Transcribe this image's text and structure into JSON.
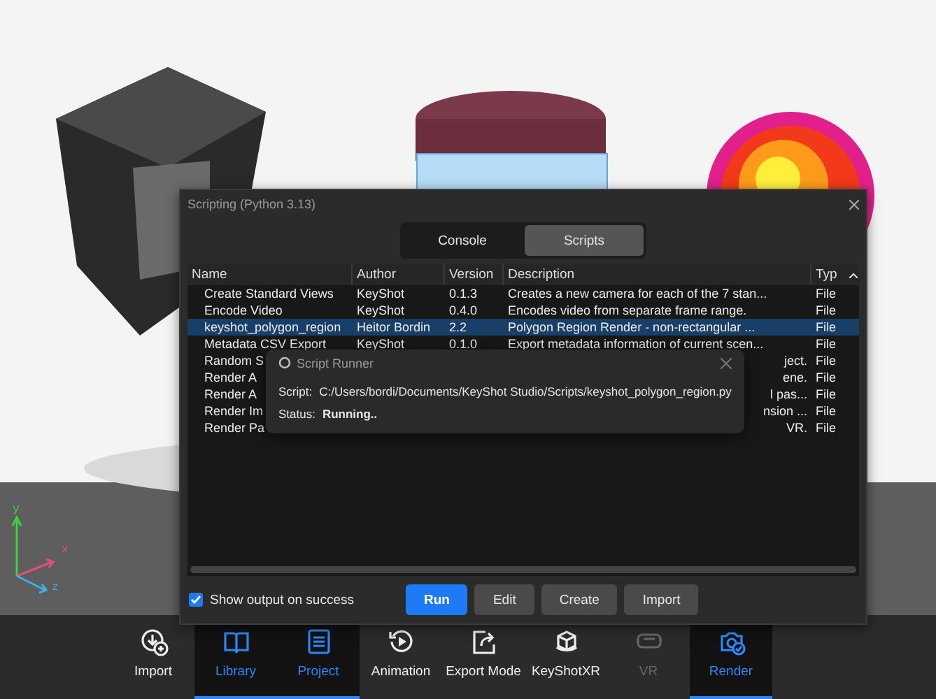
{
  "viewport": {
    "kind": "picture",
    "axis_labels": [
      "y",
      "x",
      "z"
    ]
  },
  "dialog": {
    "title": "Scripting (Python 3.13)",
    "tabs": [
      {
        "label": "Console",
        "selected": false
      },
      {
        "label": "Scripts",
        "selected": true
      }
    ],
    "table": {
      "columns": [
        "Name",
        "Author",
        "Version",
        "Description",
        "Typ"
      ],
      "rows": [
        {
          "kind": "full",
          "name": "Create Standard Views",
          "author": "KeyShot",
          "version": "0.1.3",
          "description": "Creates a new camera for each of the 7 stan...",
          "type": "File",
          "selected": false
        },
        {
          "kind": "full",
          "name": "Encode Video",
          "author": "KeyShot",
          "version": "0.4.0",
          "description": "Encodes video from separate frame range.",
          "type": "File",
          "selected": false
        },
        {
          "kind": "full",
          "name": "keyshot_polygon_region",
          "author": "Heitor Bordin",
          "version": "2.2",
          "description": "Polygon Region Render  -  non-rectangular ...",
          "type": "File",
          "selected": true
        },
        {
          "kind": "full",
          "name": "Metadata CSV Export",
          "author": "KeyShot",
          "version": "0.1.0",
          "description": "Export metadata information of current scen...",
          "type": "File",
          "selected": false
        },
        {
          "kind": "partial",
          "name": "Random S",
          "description": "ject.",
          "type": "File",
          "selected": false
        },
        {
          "kind": "partial",
          "name": "Render A",
          "description": "ene.",
          "type": "File",
          "selected": false
        },
        {
          "kind": "partial",
          "name": "Render A",
          "description": "l pas...",
          "type": "File",
          "selected": false
        },
        {
          "kind": "partial",
          "name": "Render Im",
          "description": "nsion ...",
          "type": "File",
          "selected": false
        },
        {
          "kind": "partial",
          "name": "Render Pa",
          "description": "VR.",
          "type": "File",
          "selected": false
        }
      ]
    },
    "show_output": {
      "label": "Show output on success",
      "checked": true
    },
    "buttons": [
      {
        "label": "Run",
        "kind": "primary"
      },
      {
        "label": "Edit",
        "kind": "secondary"
      },
      {
        "label": "Create",
        "kind": "secondary"
      },
      {
        "label": "Import",
        "kind": "secondary"
      }
    ]
  },
  "runner": {
    "title": "Script Runner",
    "script_label": "Script:",
    "script_path": "C:/Users/bordi/Documents/KeyShot Studio/Scripts/keyshot_polygon_region.py",
    "status_label": "Status:",
    "status": "Running.."
  },
  "toolbar": [
    {
      "label": "Import",
      "kind": "import",
      "selected": false,
      "disabled": false
    },
    {
      "label": "Library",
      "kind": "book",
      "selected": true,
      "disabled": false
    },
    {
      "label": "Project",
      "kind": "list",
      "selected": true,
      "disabled": false
    },
    {
      "label": "Animation",
      "kind": "play",
      "selected": false,
      "disabled": false
    },
    {
      "label": "Export Mode",
      "kind": "share",
      "selected": false,
      "disabled": false
    },
    {
      "label": "KeyShotXR",
      "kind": "cube",
      "selected": false,
      "disabled": false
    },
    {
      "label": "VR",
      "kind": "headset",
      "selected": false,
      "disabled": true
    },
    {
      "label": "Render",
      "kind": "camera",
      "selected": true,
      "disabled": false
    }
  ]
}
